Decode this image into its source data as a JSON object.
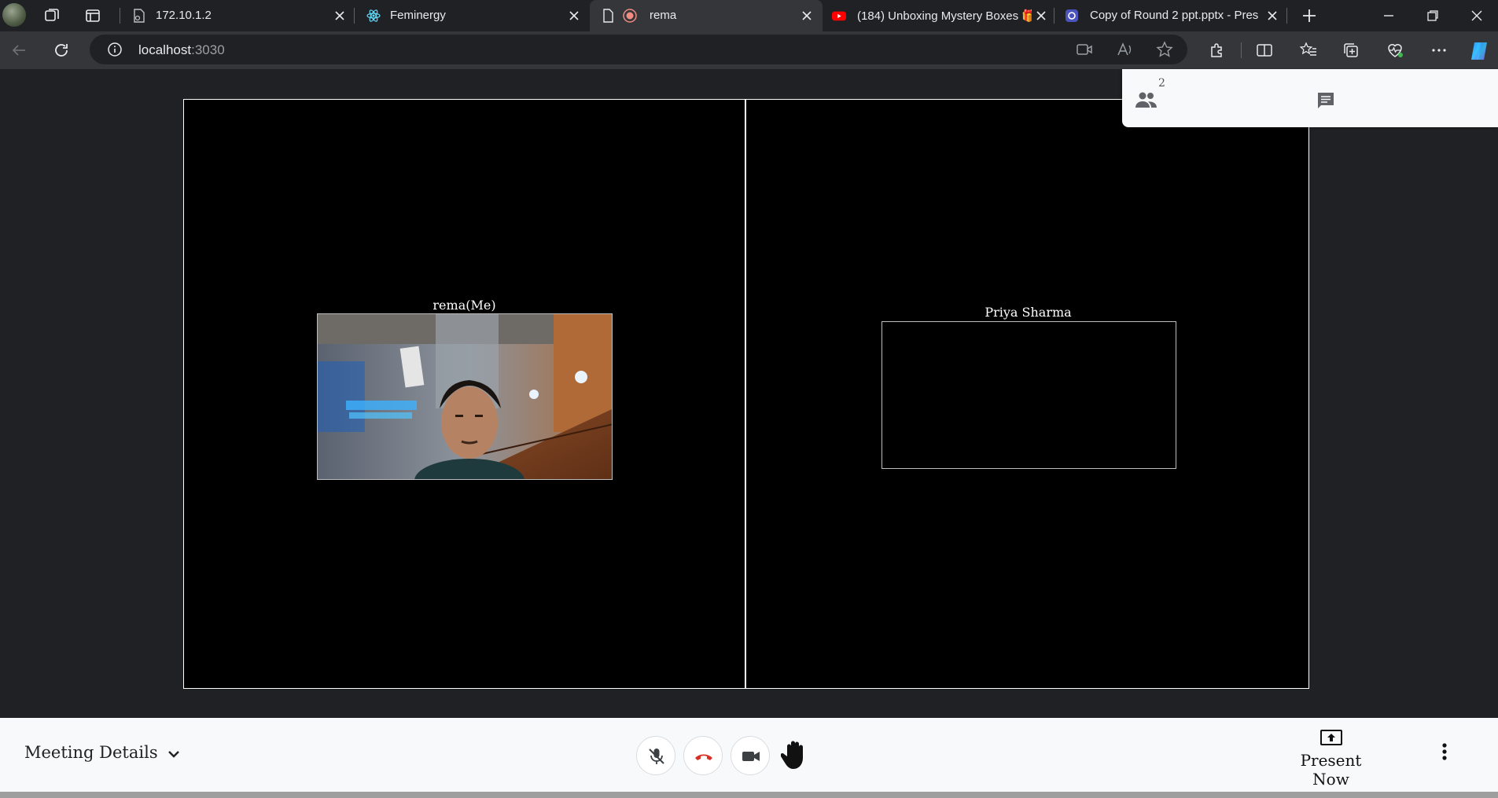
{
  "browser": {
    "tabs": [
      {
        "title": "172.10.1.2",
        "icon": "network-file-icon"
      },
      {
        "title": "Feminergy",
        "icon": "react-logo-icon"
      },
      {
        "title": "rema",
        "icon": "page-icon",
        "active": true,
        "recording": true
      },
      {
        "title": "(184) Unboxing Mystery Boxes 🎁",
        "icon": "youtube-icon"
      },
      {
        "title": "Copy of Round 2 ppt.pptx - Pres",
        "icon": "office-icon"
      }
    ],
    "address": {
      "host": "localhost",
      "port": ":3030"
    }
  },
  "meeting": {
    "participants": [
      {
        "name": "rema(Me)",
        "has_video": true
      },
      {
        "name": "Priya Sharma",
        "has_video": false
      }
    ],
    "participant_count": "2",
    "controls": {
      "meeting_details": "Meeting Details",
      "present_now": "Present Now"
    }
  },
  "colors": {
    "end_call": "#d93025",
    "panel_bg": "#f8f9fa",
    "video_bg": "#000000"
  }
}
